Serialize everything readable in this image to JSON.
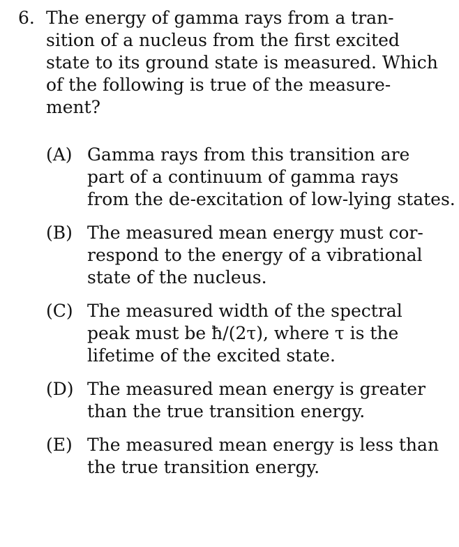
{
  "question": {
    "number": "6.",
    "stem_lines": [
      "The energy of gamma rays from a tran-",
      "sition of a nucleus from the first excited",
      "state to its ground state is measured. Which",
      "of the following is true of the measure-",
      "ment?"
    ],
    "options": [
      {
        "letter": "(A)",
        "lines": [
          "Gamma rays from this transition are",
          "part of a continuum of gamma rays",
          "from the de-excitation of low-lying states."
        ]
      },
      {
        "letter": "(B)",
        "lines": [
          "The measured mean energy must cor-",
          "respond to the energy of a vibrational",
          "state of the nucleus."
        ]
      },
      {
        "letter": "(C)",
        "lines": [
          "The measured width of the spectral",
          "peak must be ħ/(2τ), where τ is the",
          "lifetime of the excited state."
        ]
      },
      {
        "letter": "(D)",
        "lines": [
          "The measured mean energy is greater",
          "than the true transition energy."
        ]
      },
      {
        "letter": "(E)",
        "lines": [
          "The measured mean energy is less than",
          "the true transition energy."
        ]
      }
    ]
  }
}
